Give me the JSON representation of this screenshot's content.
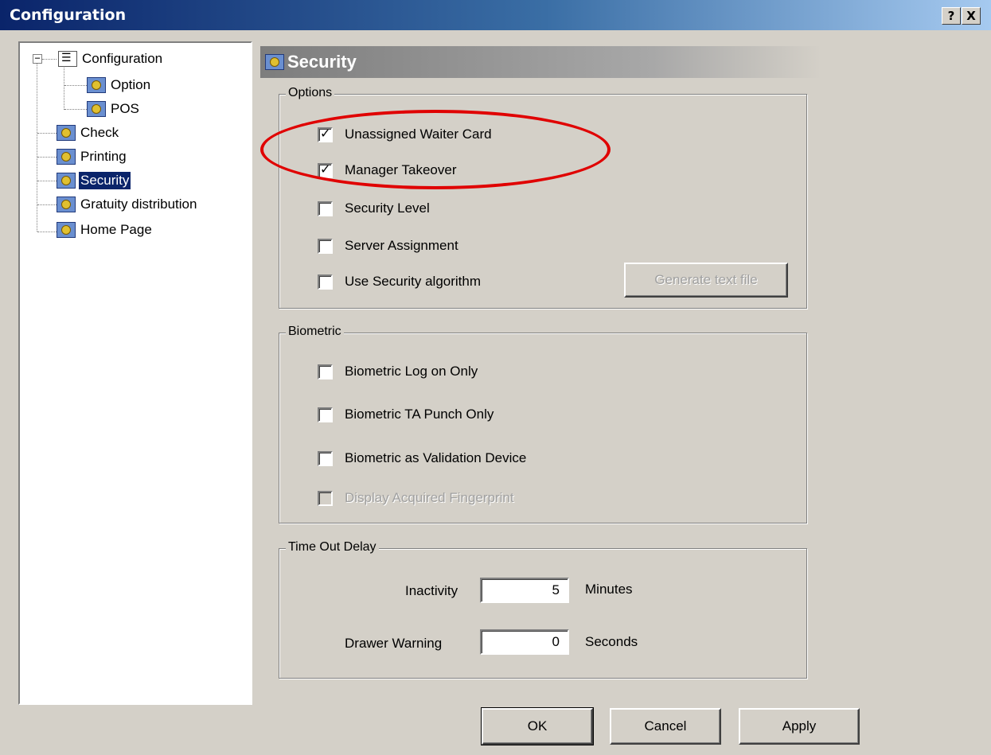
{
  "window": {
    "title": "Configuration",
    "help_label": "?",
    "close_label": "X"
  },
  "tree": {
    "root": "Configuration",
    "children": [
      "Option",
      "POS"
    ],
    "items": [
      "Check",
      "Printing",
      "Security",
      "Gratuity distribution",
      "Home Page"
    ],
    "selected": "Security"
  },
  "panel": {
    "title": "Security"
  },
  "options": {
    "legend": "Options",
    "items": [
      {
        "label": "Unassigned Waiter Card",
        "checked": true
      },
      {
        "label": "Manager Takeover",
        "checked": true
      },
      {
        "label": "Security Level",
        "checked": false
      },
      {
        "label": "Server Assignment",
        "checked": false
      },
      {
        "label": "Use Security algorithm",
        "checked": false
      }
    ],
    "generate_button": "Generate text file"
  },
  "biometric": {
    "legend": "Biometric",
    "items": [
      {
        "label": "Biometric Log on Only",
        "checked": false
      },
      {
        "label": "Biometric TA Punch Only",
        "checked": false
      },
      {
        "label": "Biometric as Validation Device",
        "checked": false
      },
      {
        "label": "Display Acquired Fingerprint",
        "checked": false,
        "disabled": true
      }
    ]
  },
  "timeout": {
    "legend": "Time Out Delay",
    "inactivity_label": "Inactivity",
    "inactivity_value": "5",
    "inactivity_unit": "Minutes",
    "drawer_label": "Drawer Warning",
    "drawer_value": "0",
    "drawer_unit": "Seconds"
  },
  "buttons": {
    "ok": "OK",
    "cancel": "Cancel",
    "apply": "Apply"
  },
  "annotation_color": "#e00000"
}
